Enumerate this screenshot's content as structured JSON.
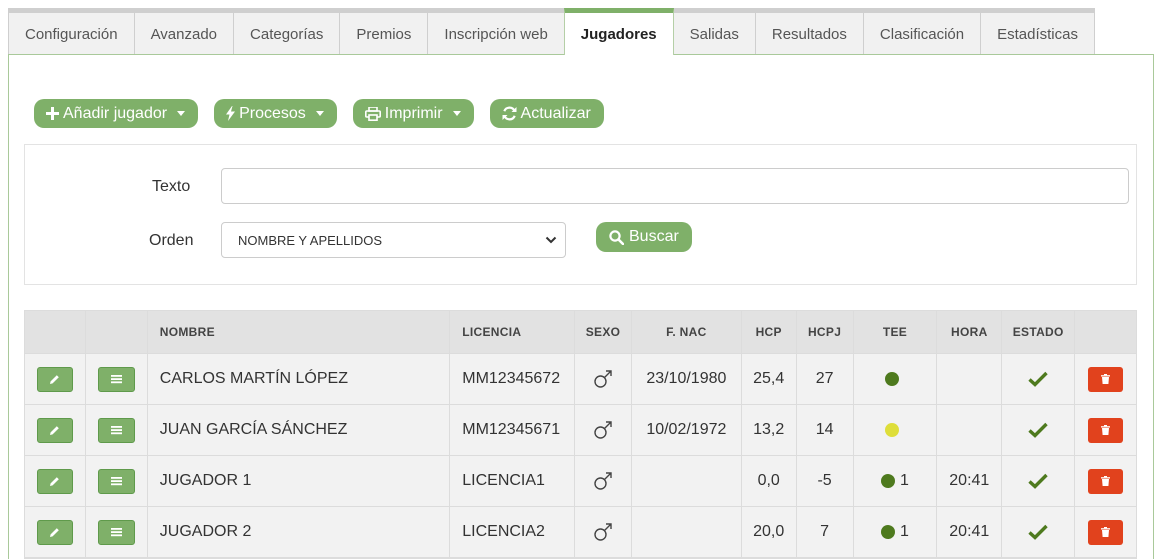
{
  "tabs": [
    {
      "label": "Configuración",
      "active": false
    },
    {
      "label": "Avanzado",
      "active": false
    },
    {
      "label": "Categorías",
      "active": false
    },
    {
      "label": "Premios",
      "active": false
    },
    {
      "label": "Inscripción web",
      "active": false
    },
    {
      "label": "Jugadores",
      "active": true
    },
    {
      "label": "Salidas",
      "active": false
    },
    {
      "label": "Resultados",
      "active": false
    },
    {
      "label": "Clasificación",
      "active": false
    },
    {
      "label": "Estadísticas",
      "active": false
    }
  ],
  "toolbar": {
    "add_player": "Añadir jugador",
    "processes": "Procesos",
    "print": "Imprimir",
    "refresh": "Actualizar"
  },
  "filter": {
    "text_label": "Texto",
    "text_value": "",
    "order_label": "Orden",
    "order_value": "NOMBRE Y APELLIDOS",
    "search_button": "Buscar"
  },
  "table": {
    "headers": [
      "",
      "",
      "NOMBRE",
      "LICENCIA",
      "SEXO",
      "F. NAC",
      "HCP",
      "HCPJ",
      "TEE",
      "HORA",
      "ESTADO",
      ""
    ],
    "rows": [
      {
        "nombre": "CARLOS MARTÍN LÓPEZ",
        "licencia": "MM12345672",
        "sexo": "♂",
        "fnac": "23/10/1980",
        "hcp": "25,4",
        "hcpj": "27",
        "tee_color": "#4e7a1e",
        "tee": "",
        "hora": ""
      },
      {
        "nombre": "JUAN GARCÍA SÁNCHEZ",
        "licencia": "MM12345671",
        "sexo": "♂",
        "fnac": "10/02/1972",
        "hcp": "13,2",
        "hcpj": "14",
        "tee_color": "#dede3a",
        "tee": "",
        "hora": ""
      },
      {
        "nombre": "JUGADOR 1",
        "licencia": "LICENCIA1",
        "sexo": "♂",
        "fnac": "",
        "hcp": "0,0",
        "hcpj": "-5",
        "tee_color": "#4e7a1e",
        "tee": "1",
        "hora": "20:41"
      },
      {
        "nombre": "JUGADOR 2",
        "licencia": "LICENCIA2",
        "sexo": "♂",
        "fnac": "",
        "hcp": "20,0",
        "hcpj": "7",
        "tee_color": "#4e7a1e",
        "tee": "1",
        "hora": "20:41"
      }
    ]
  },
  "colors": {
    "accent": "#7fb069",
    "danger": "#e1421d",
    "check": "#4e7a1e"
  }
}
